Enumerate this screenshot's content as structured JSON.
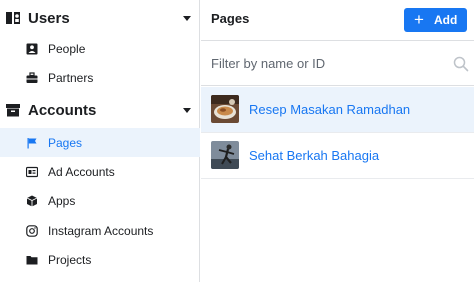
{
  "sidebar": {
    "users": {
      "title": "Users",
      "icon": "users-icon",
      "items": [
        {
          "label": "People",
          "icon": "person-icon"
        },
        {
          "label": "Partners",
          "icon": "briefcase-icon"
        }
      ]
    },
    "accounts": {
      "title": "Accounts",
      "icon": "accounts-icon",
      "items": [
        {
          "label": "Pages",
          "icon": "flag-icon",
          "active": true
        },
        {
          "label": "Ad Accounts",
          "icon": "ad-accounts-icon"
        },
        {
          "label": "Apps",
          "icon": "cube-icon"
        },
        {
          "label": "Instagram Accounts",
          "icon": "instagram-icon"
        },
        {
          "label": "Projects",
          "icon": "folder-icon"
        }
      ]
    }
  },
  "main": {
    "title": "Pages",
    "add_button": {
      "label": "Add",
      "icon": "plus-icon"
    },
    "filter": {
      "placeholder": "Filter by name or ID",
      "value": "",
      "icon": "search-icon"
    },
    "pages": [
      {
        "name": "Resep Masakan Ramadhan",
        "selected": true
      },
      {
        "name": "Sehat Berkah Bahagia",
        "selected": false
      }
    ]
  },
  "colors": {
    "accent": "#1877f2",
    "active_bg": "#ebf3fc",
    "border": "#dddfe2",
    "text": "#1c1e21",
    "muted": "#606770"
  }
}
